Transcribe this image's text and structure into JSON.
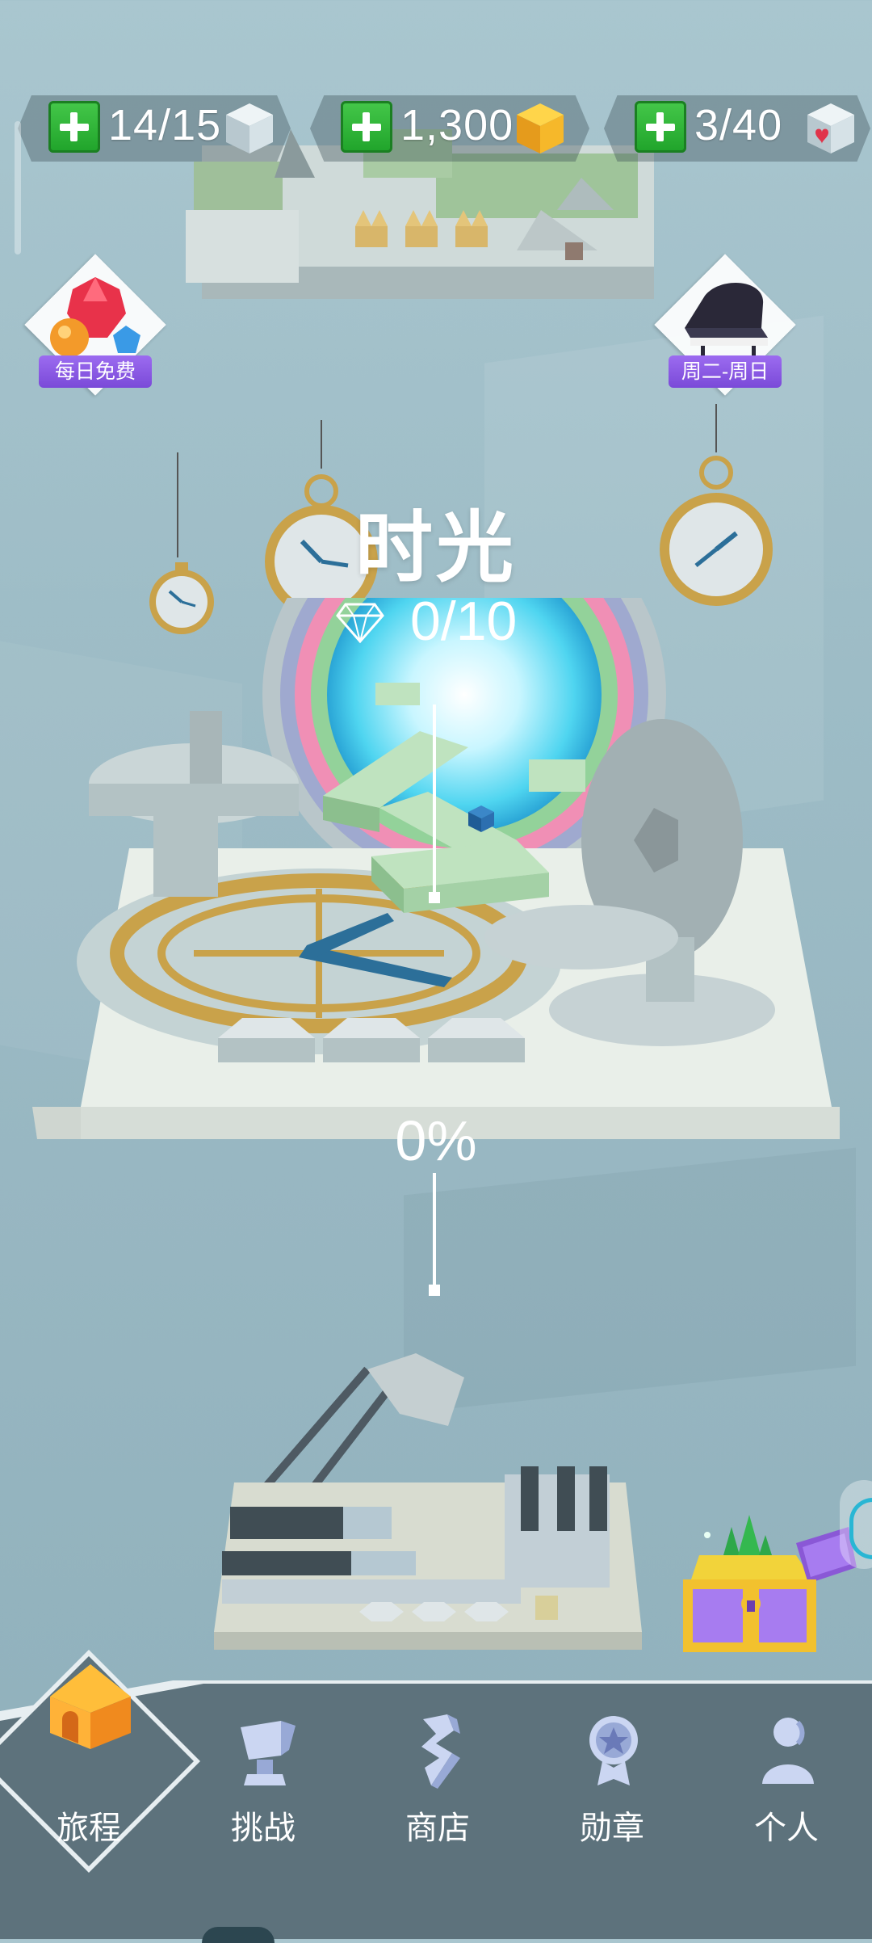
{
  "resources": {
    "energy": {
      "value": "14/15",
      "icon": "white-cube-icon"
    },
    "coins": {
      "value": "1,300",
      "icon": "gold-cube-icon"
    },
    "hearts": {
      "value": "3/40",
      "icon": "heart-cube-icon"
    }
  },
  "badges": {
    "daily_free": {
      "label": "每日免费",
      "icon": "gems-icon"
    },
    "weekly": {
      "label": "周二-周日",
      "icon": "piano-icon"
    }
  },
  "level": {
    "title": "时光",
    "gems": "0/10",
    "percent": "0%",
    "progress": 0
  },
  "nav": {
    "items": [
      {
        "label": "旅程",
        "icon": "house-icon",
        "active": true
      },
      {
        "label": "挑战",
        "icon": "trophy-icon",
        "active": false
      },
      {
        "label": "商店",
        "icon": "shop-icon",
        "active": false
      },
      {
        "label": "勋章",
        "icon": "medal-icon",
        "active": false
      },
      {
        "label": "个人",
        "icon": "person-icon",
        "active": false
      }
    ]
  },
  "colors": {
    "background": "#9dbcc6",
    "nav_bg": "#5d727c",
    "plus_green": "#2fb83a",
    "badge_purple": "#8a5ae6",
    "gold": "#c9a24a",
    "path_green": "#bfe3bf"
  }
}
